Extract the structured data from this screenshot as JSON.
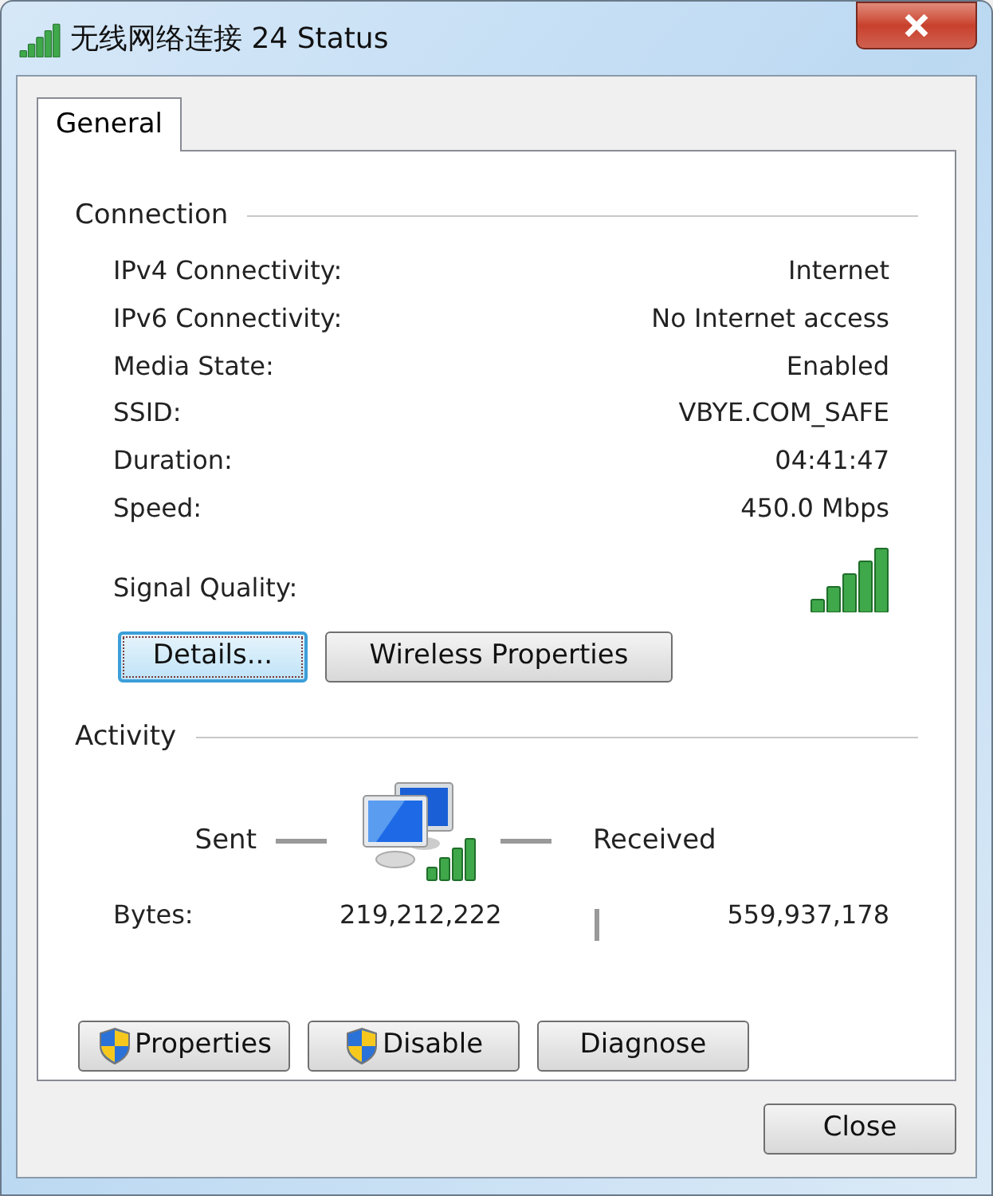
{
  "window": {
    "title": "无线网络连接 24 Status"
  },
  "tabs": [
    {
      "label": "General",
      "selected": true
    }
  ],
  "connection": {
    "heading": "Connection",
    "rows": [
      {
        "label": "IPv4 Connectivity:",
        "value": "Internet"
      },
      {
        "label": "IPv6 Connectivity:",
        "value": "No Internet access"
      },
      {
        "label": "Media State:",
        "value": "Enabled"
      },
      {
        "label": "SSID:",
        "value": "VBYE.COM_SAFE"
      },
      {
        "label": "Duration:",
        "value": "04:41:47"
      },
      {
        "label": "Speed:",
        "value": "450.0 Mbps"
      }
    ],
    "signal_label": "Signal Quality:",
    "buttons": [
      {
        "label": "Details...",
        "focused": true
      },
      {
        "label": "Wireless Properties",
        "focused": false
      }
    ]
  },
  "activity": {
    "heading": "Activity",
    "sent_label": "Sent",
    "received_label": "Received",
    "bytes_label": "Bytes:",
    "sent": "219,212,222",
    "received": "559,937,178"
  },
  "actions": [
    {
      "label": "Properties",
      "shield": true
    },
    {
      "label": "Disable",
      "shield": true
    },
    {
      "label": "Diagnose",
      "shield": false
    }
  ],
  "close_button": "Close"
}
